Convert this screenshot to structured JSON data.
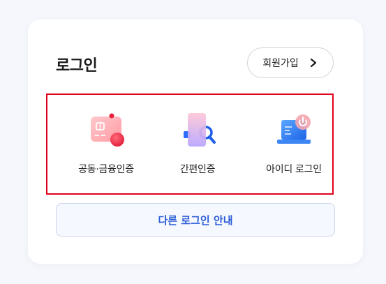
{
  "login": {
    "title": "로그인",
    "signup_label": "회원가입",
    "options": [
      {
        "label": "공동·금융인증",
        "icon": "certificate-card-icon"
      },
      {
        "label": "간편인증",
        "icon": "simple-auth-icon"
      },
      {
        "label": "아이디 로그인",
        "icon": "laptop-power-icon"
      }
    ],
    "other_login_guide": "다른 로그인 안내"
  },
  "colors": {
    "highlight_border": "#e0001b",
    "guide_text": "#2b5bd7",
    "guide_bg": "#f5f8fe"
  }
}
